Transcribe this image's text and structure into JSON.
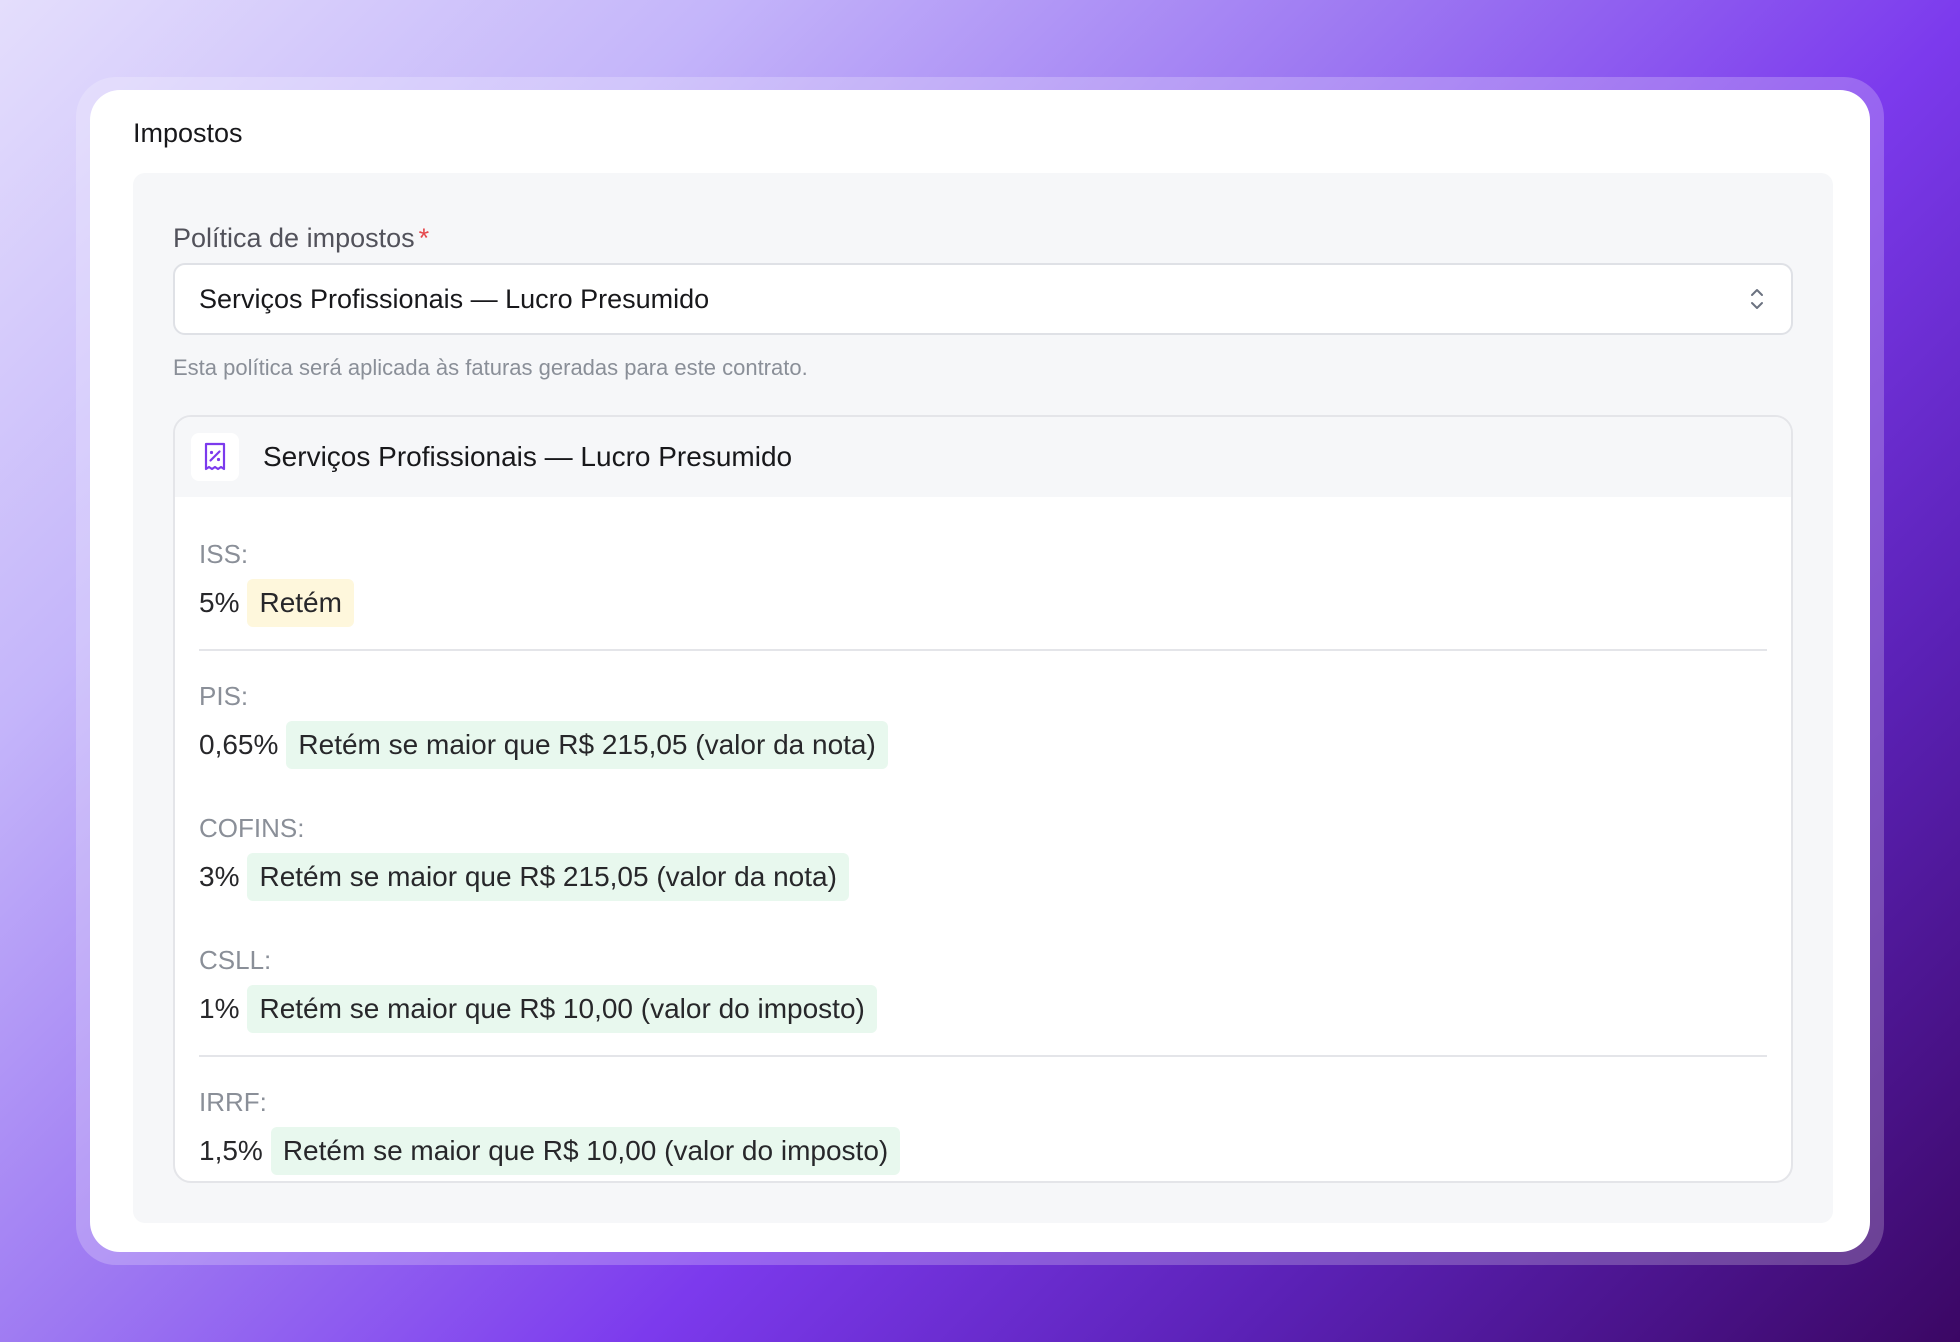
{
  "section": {
    "title": "Impostos"
  },
  "field": {
    "label": "Política de impostos",
    "required_mark": "*",
    "selected_value": "Serviços Profissionais — Lucro Presumido",
    "helper": "Esta política será aplicada às faturas geradas para este contrato."
  },
  "policy": {
    "title": "Serviços Profissionais — Lucro Presumido",
    "icon": "receipt-percent-icon",
    "taxes": [
      {
        "name": "ISS:",
        "rate": "5%",
        "badge": "Retém",
        "badge_color": "#fef7dc"
      },
      {
        "name": "PIS:",
        "rate": "0,65%",
        "badge": "Retém se maior que R$ 215,05 (valor da nota)",
        "badge_color": "#e8f8ee"
      },
      {
        "name": "COFINS:",
        "rate": "3%",
        "badge": "Retém se maior que R$ 215,05 (valor da nota)",
        "badge_color": "#e8f8ee"
      },
      {
        "name": "CSLL:",
        "rate": "1%",
        "badge": "Retém se maior que R$ 10,00 (valor do imposto)",
        "badge_color": "#e8f8ee"
      },
      {
        "name": "IRRF:",
        "rate": "1,5%",
        "badge": "Retém se maior que R$ 10,00 (valor do imposto)",
        "badge_color": "#e8f8ee"
      }
    ]
  },
  "colors": {
    "accent": "#7c3aed",
    "required": "#e5484d"
  }
}
